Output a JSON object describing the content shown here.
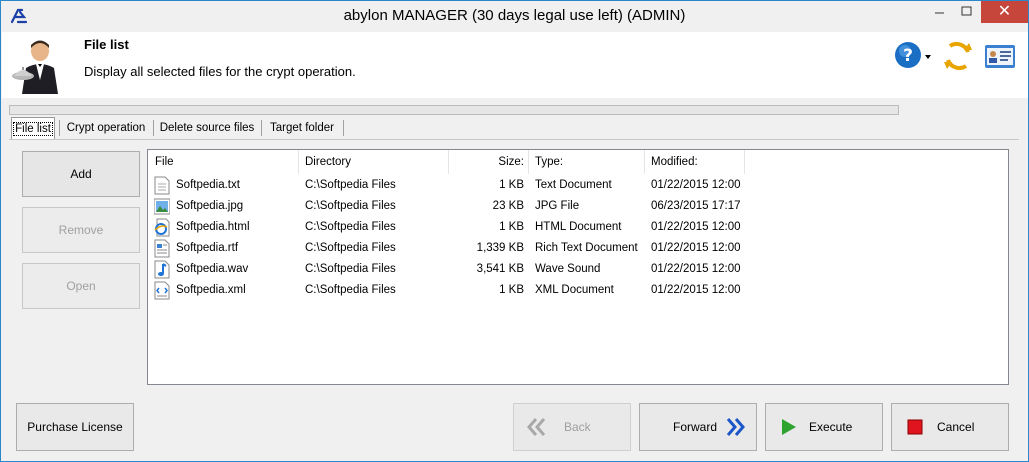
{
  "window": {
    "title": "abylon MANAGER (30 days legal use left) (ADMIN)",
    "close_glyph": "✕",
    "minimize_glyph": "—",
    "maximize_glyph": "☐"
  },
  "header": {
    "title": "File list",
    "subtitle": "Display all selected files for the crypt operation.",
    "icons": [
      "butler-icon",
      "help-icon",
      "refresh-icon",
      "license-card-icon"
    ]
  },
  "tabs": [
    {
      "label": "File list",
      "active": true
    },
    {
      "label": "Crypt operation",
      "active": false
    },
    {
      "label": "Delete source files",
      "active": false
    },
    {
      "label": "Target folder",
      "active": false
    }
  ],
  "side_buttons": {
    "add": "Add",
    "remove": "Remove",
    "open": "Open"
  },
  "file_table": {
    "columns": [
      "File",
      "Directory",
      "Size:",
      "Type:",
      "Modified:"
    ],
    "rows": [
      {
        "name": "Softpedia.txt",
        "dir": "C:\\Softpedia Files",
        "size": "1 KB",
        "type": "Text Document",
        "modified": "01/22/2015 12:00",
        "icon": "text-file-icon"
      },
      {
        "name": "Softpedia.jpg",
        "dir": "C:\\Softpedia Files",
        "size": "23 KB",
        "type": "JPG File",
        "modified": "06/23/2015 17:17",
        "icon": "image-file-icon"
      },
      {
        "name": "Softpedia.html",
        "dir": "C:\\Softpedia Files",
        "size": "1 KB",
        "type": "HTML Document",
        "modified": "01/22/2015 12:00",
        "icon": "html-file-icon"
      },
      {
        "name": "Softpedia.rtf",
        "dir": "C:\\Softpedia Files",
        "size": "1,339 KB",
        "type": "Rich Text Document",
        "modified": "01/22/2015 12:00",
        "icon": "rtf-file-icon"
      },
      {
        "name": "Softpedia.wav",
        "dir": "C:\\Softpedia Files",
        "size": "3,541 KB",
        "type": "Wave Sound",
        "modified": "01/22/2015 12:00",
        "icon": "audio-file-icon"
      },
      {
        "name": "Softpedia.xml",
        "dir": "C:\\Softpedia Files",
        "size": "1 KB",
        "type": "XML Document",
        "modified": "01/22/2015 12:00",
        "icon": "xml-file-icon"
      }
    ]
  },
  "footer": {
    "purchase": "Purchase License",
    "back": "Back",
    "forward": "Forward",
    "execute": "Execute",
    "cancel": "Cancel"
  },
  "colors": {
    "accent": "#1c56a8",
    "execute_green": "#2fa32f",
    "cancel_red": "#e0141e",
    "close_red": "#c7463c"
  }
}
